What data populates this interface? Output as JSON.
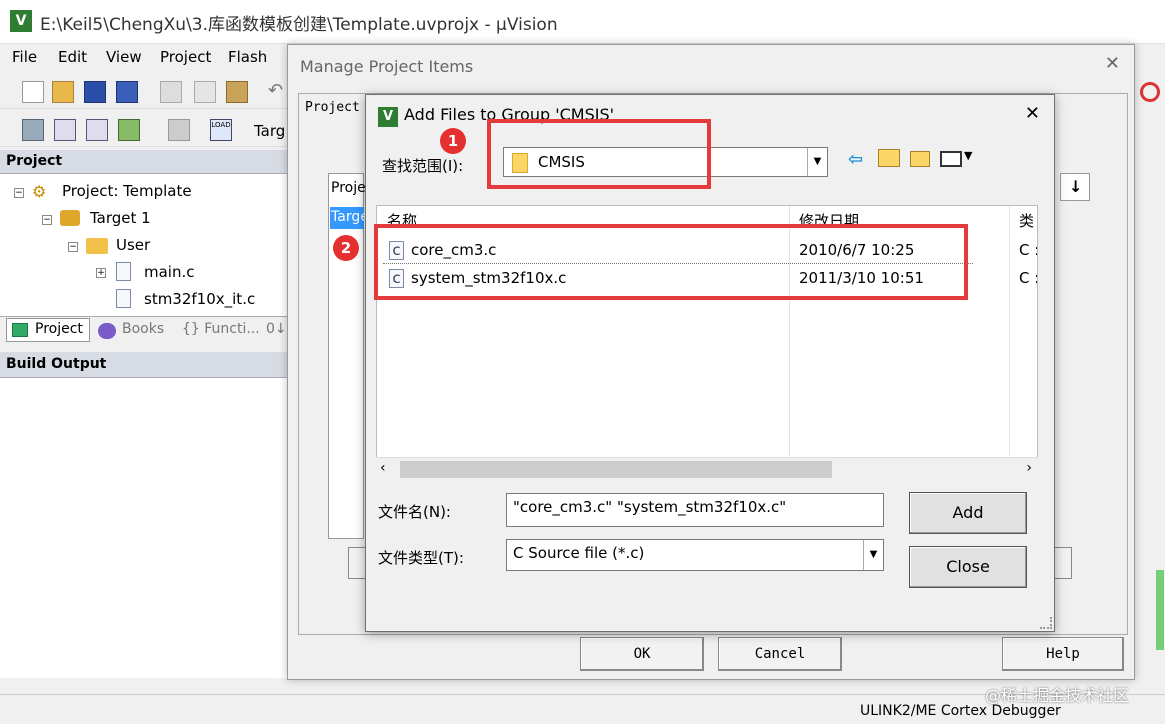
{
  "window": {
    "title": "E:\\Keil5\\ChengXu\\3.库函数模板创建\\Template.uvprojx - µVision"
  },
  "menu": [
    "File",
    "Edit",
    "View",
    "Project",
    "Flash"
  ],
  "toolbar2": {
    "target_label": "Targ"
  },
  "project_panel": {
    "header": "Project",
    "tree": [
      "Project: Template",
      "Target 1",
      "User",
      "main.c",
      "stm32f10x_it.c"
    ],
    "tabs": [
      "Project",
      "Books",
      "{} Functi...",
      "0↓"
    ]
  },
  "build_output": {
    "header": "Build Output"
  },
  "status_bar": {
    "text": "ULINK2/ME Cortex Debugger"
  },
  "watermark": "@稀土掘金技术社区",
  "manage_dialog": {
    "title": "Manage Project Items",
    "tab_label": "Project",
    "list_header": "Proje",
    "list_item": "Targe",
    "ok": "OK",
    "cancel": "Cancel",
    "help": "Help"
  },
  "add_dialog": {
    "title": "Add Files to Group 'CMSIS'",
    "look_in_label": "查找范围(I):",
    "look_in_value": "CMSIS",
    "columns": [
      "名称",
      "修改日期",
      "类"
    ],
    "files": [
      {
        "name": "core_cm3.c",
        "date": "2010/6/7 10:25",
        "type": "C :"
      },
      {
        "name": "system_stm32f10x.c",
        "date": "2011/3/10 10:51",
        "type": "C :"
      }
    ],
    "filename_label": "文件名(N):",
    "filename_value": "\"core_cm3.c\" \"system_stm32f10x.c\"",
    "filetype_label": "文件类型(T):",
    "filetype_value": "C Source file (*.c)",
    "add": "Add",
    "close": "Close"
  },
  "annotations": [
    "1",
    "2"
  ],
  "colors": {
    "highlight": "#e33b3b",
    "selected": "#3399ff"
  }
}
